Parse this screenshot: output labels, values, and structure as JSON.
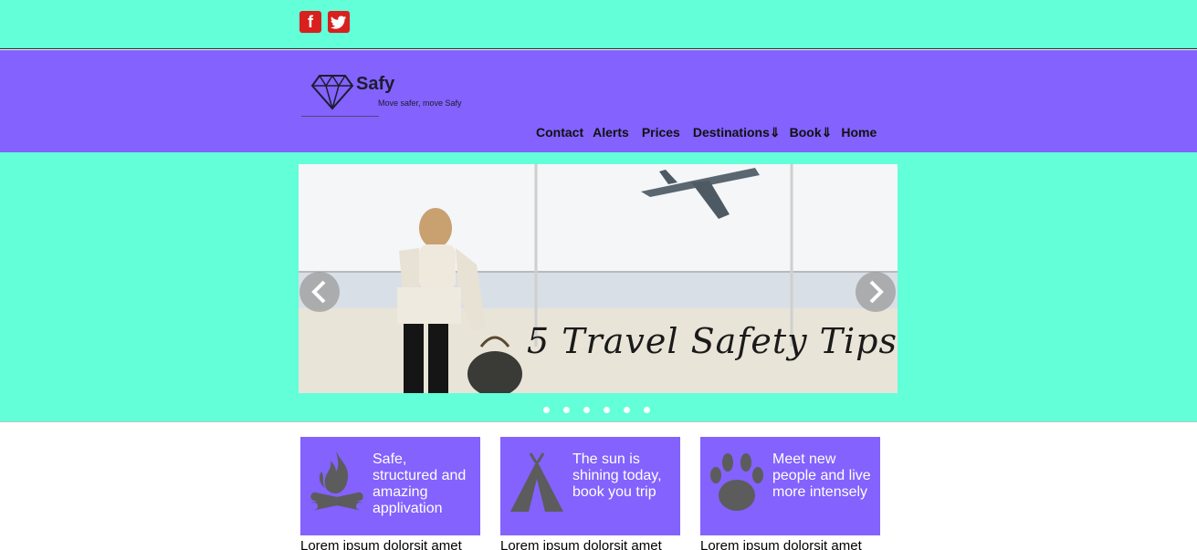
{
  "social": {
    "facebook_glyph": "f",
    "facebook_color": "#d8201e",
    "twitter_color": "#d8201e"
  },
  "brand": {
    "name": "Safy",
    "tagline": "Move safer, move Safy"
  },
  "nav": {
    "items": [
      "Contact",
      "Alerts",
      "Prices",
      "Destinations⇓",
      "Book⇓",
      "Home"
    ]
  },
  "slider": {
    "caption": "5 Travel Safety Tips",
    "dot_count": 6,
    "active_dot": 1
  },
  "cards": [
    {
      "icon": "campfire-icon",
      "text": "Safe, structured and amazing applivation",
      "below": "Lorem ipsum dolorsit amet"
    },
    {
      "icon": "tent-icon",
      "text": "The sun is shining today, book you trip",
      "below": "Lorem ipsum dolorsit amet"
    },
    {
      "icon": "paw-icon",
      "text": "Meet new people and live more intensely",
      "below": "Lorem ipsum dolorsit amet"
    }
  ],
  "colors": {
    "mint": "#63ffd8",
    "purple": "#8362fd",
    "icon_gray": "#5c5c5c"
  }
}
